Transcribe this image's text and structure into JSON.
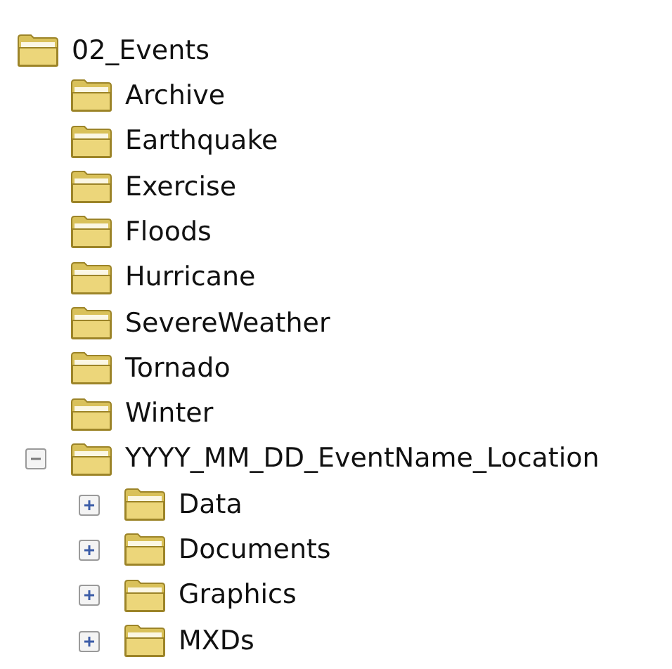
{
  "tree": [
    {
      "label": "02_Events",
      "children": [
        {
          "label": "Archive"
        },
        {
          "label": "Earthquake"
        },
        {
          "label": "Exercise"
        },
        {
          "label": "Floods"
        },
        {
          "label": "Hurricane"
        },
        {
          "label": "SevereWeather"
        },
        {
          "label": "Tornado"
        },
        {
          "label": "Winter"
        },
        {
          "label": "YYYY_MM_DD_EventName_Location",
          "expanded": true,
          "children": [
            {
              "label": "Data",
              "expanded": false
            },
            {
              "label": "Documents",
              "expanded": false
            },
            {
              "label": "Graphics",
              "expanded": false
            },
            {
              "label": "MXDs",
              "expanded": false
            }
          ]
        }
      ]
    }
  ]
}
